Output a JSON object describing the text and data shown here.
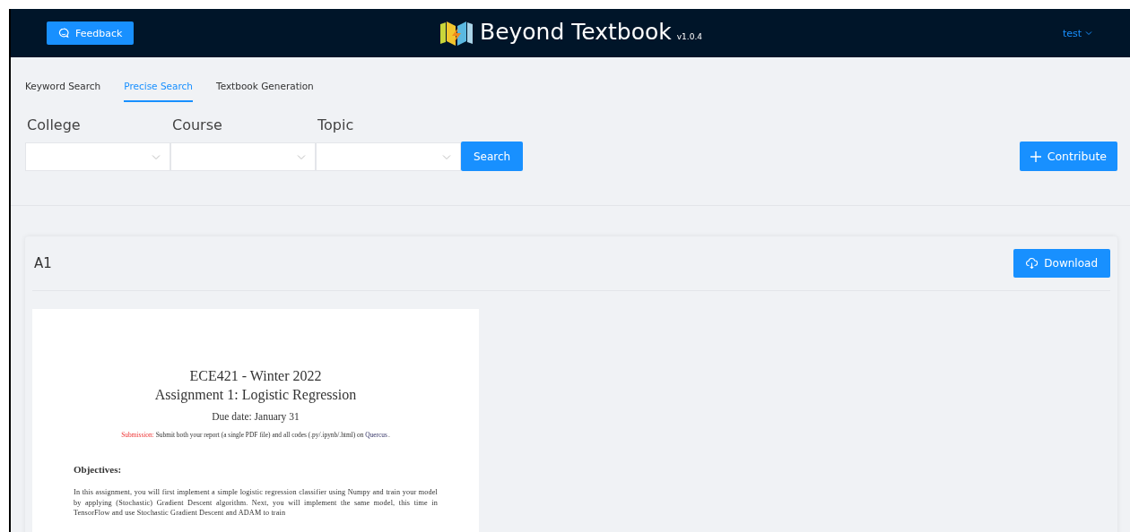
{
  "header": {
    "feedback_button": "Feedback",
    "brand": "Beyond Textbook",
    "version": "v1.0.4",
    "user_menu": "test"
  },
  "tabs": [
    {
      "label": "Keyword Search",
      "selected": false
    },
    {
      "label": "Precise Search",
      "selected": true
    },
    {
      "label": "Textbook Generation",
      "selected": false
    }
  ],
  "filters": [
    {
      "label": "College"
    },
    {
      "label": "Course"
    },
    {
      "label": "Topic"
    }
  ],
  "search_button": "Search",
  "contribute_button": "Contribute",
  "result": {
    "title": "A1",
    "download_button": "Download",
    "document": {
      "title": "ECE421 - Winter 2022",
      "subtitle": "Assignment 1: Logistic Regression",
      "due": "Due date: January 31",
      "submission_label": "Submission:",
      "submission_text": "Submit both your report (a single PDF file) and all codes (.py/.ipynb/.html) on",
      "submission_link": "Quercus",
      "submission_end": ".",
      "section": "Objectives:",
      "paragraph": "In this assignment, you will first implement a simple logistic regression classifier using Numpy and train your model by applying (Stochastic) Gradient Descent algorithm. Next, you will implement the same model, this time in TensorFlow and use Stochastic Gradient Descent and ADAM to train"
    }
  }
}
